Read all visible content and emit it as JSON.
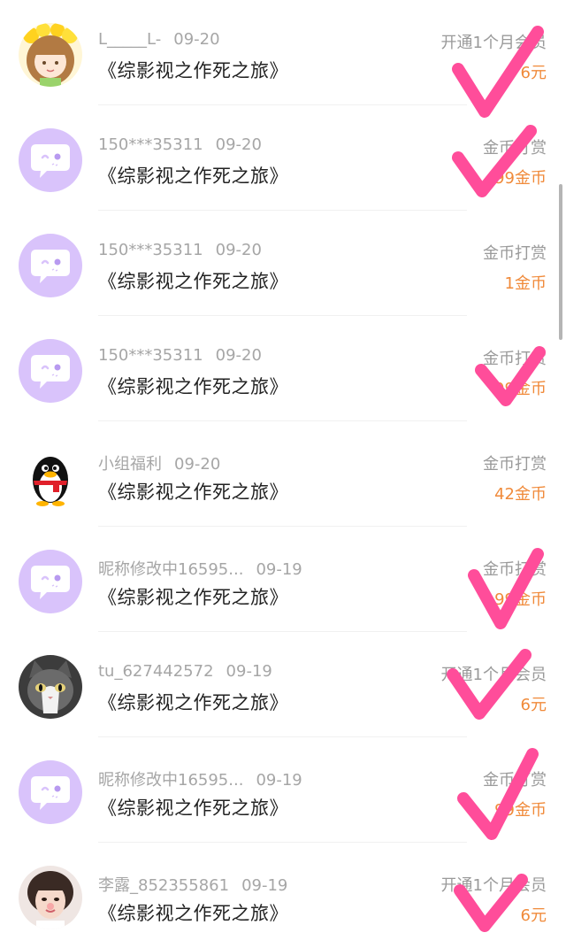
{
  "items": [
    {
      "user": "L_____L-",
      "date": "09-20",
      "book": "《综影视之作死之旅》",
      "type": "开通1个月会员",
      "amount": "6元",
      "avatar": "anime-girl-avatar"
    },
    {
      "user": "150***35311",
      "date": "09-20",
      "book": "《综影视之作死之旅》",
      "type": "金币打赏",
      "amount": "99金币",
      "avatar": "default-chat-avatar"
    },
    {
      "user": "150***35311",
      "date": "09-20",
      "book": "《综影视之作死之旅》",
      "type": "金币打赏",
      "amount": "1金币",
      "avatar": "default-chat-avatar"
    },
    {
      "user": "150***35311",
      "date": "09-20",
      "book": "《综影视之作死之旅》",
      "type": "金币打赏",
      "amount": "99金币",
      "avatar": "default-chat-avatar"
    },
    {
      "user": "小组福利",
      "date": "09-20",
      "book": "《综影视之作死之旅》",
      "type": "金币打赏",
      "amount": "42金币",
      "avatar": "penguin-avatar"
    },
    {
      "user": "昵称修改中16595...",
      "date": "09-19",
      "book": "《综影视之作死之旅》",
      "type": "金币打赏",
      "amount": "99金币",
      "avatar": "default-chat-avatar"
    },
    {
      "user": "tu_627442572",
      "date": "09-19",
      "book": "《综影视之作死之旅》",
      "type": "开通1个月会员",
      "amount": "6元",
      "avatar": "cat-photo-avatar"
    },
    {
      "user": "昵称修改中16595...",
      "date": "09-19",
      "book": "《综影视之作死之旅》",
      "type": "金币打赏",
      "amount": "99金币",
      "avatar": "default-chat-avatar"
    },
    {
      "user": "李露_852355861",
      "date": "09-19",
      "book": "《综影视之作死之旅》",
      "type": "开通1个月会员",
      "amount": "6元",
      "avatar": "girl-photo-avatar"
    }
  ],
  "colors": {
    "accent_amount": "#f08a3a",
    "checkmark": "#ff4d9a",
    "avatar_default": "#d9c3fb"
  }
}
